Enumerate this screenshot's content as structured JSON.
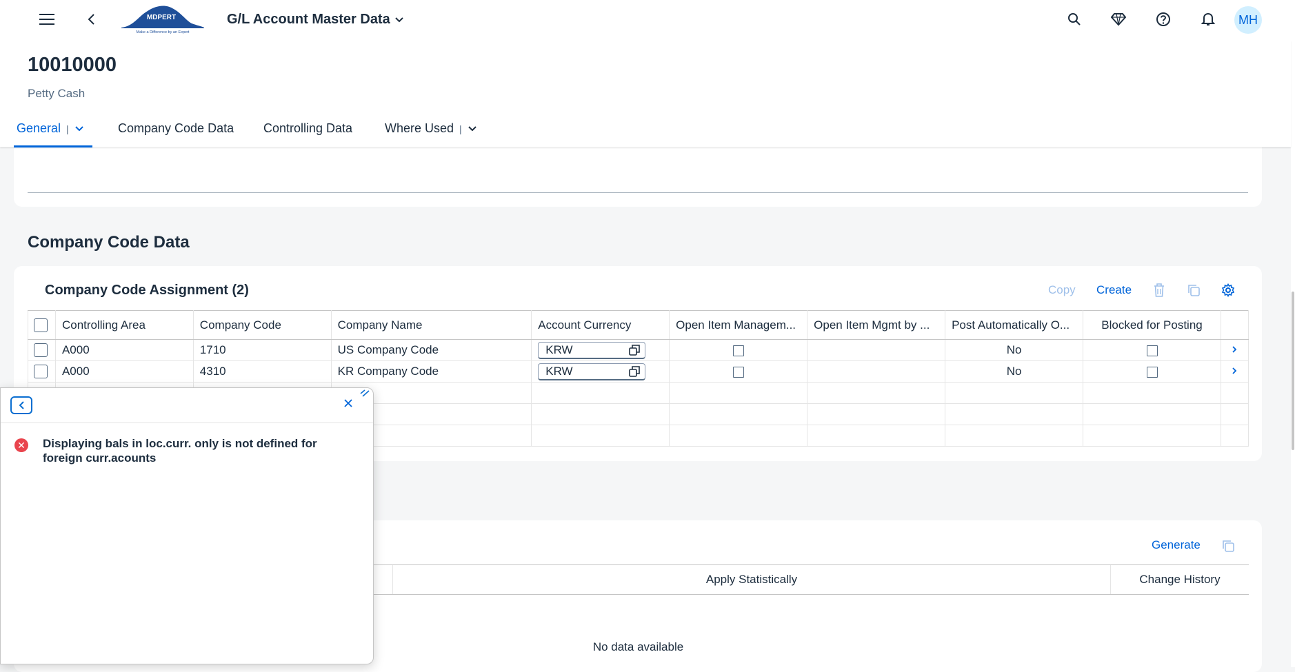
{
  "shell": {
    "title": "G/L Account Master Data",
    "logo_text": "MDPERT",
    "logo_tagline": "Make a Difference by an Expert",
    "avatar_initials": "MH"
  },
  "object": {
    "title": "10010000",
    "subtitle": "Petty Cash"
  },
  "tabs": [
    {
      "label": "General"
    },
    {
      "label": "Company Code Data"
    },
    {
      "label": "Controlling Data"
    },
    {
      "label": "Where Used"
    }
  ],
  "section": {
    "title": "Company Code Data"
  },
  "assignment_table": {
    "title": "Company Code Assignment (2)",
    "toolbar": {
      "copy": "Copy",
      "create": "Create"
    },
    "columns": [
      "Controlling Area",
      "Company Code",
      "Company Name",
      "Account Currency",
      "Open Item Managem...",
      "Open Item Mgmt by ...",
      "Post Automatically O...",
      "Blocked for Posting"
    ],
    "rows": [
      {
        "controlling_area": "A000",
        "company_code": "1710",
        "company_name": "US Company Code",
        "currency": "KRW",
        "post_auto": "No"
      },
      {
        "controlling_area": "A000",
        "company_code": "4310",
        "company_name": "KR Company Code",
        "currency": "KRW",
        "post_auto": "No"
      }
    ]
  },
  "second_table": {
    "toolbar": {
      "generate": "Generate"
    },
    "columns": [
      "Apply Statistically",
      "Change History"
    ],
    "empty_text": "No data available"
  },
  "message_popover": {
    "message": "Displaying bals in loc.curr. only is not defined for foreign curr.acounts"
  },
  "colors": {
    "accent": "#0064d9",
    "error": "#e9444d",
    "background": "#f5f6f7"
  }
}
